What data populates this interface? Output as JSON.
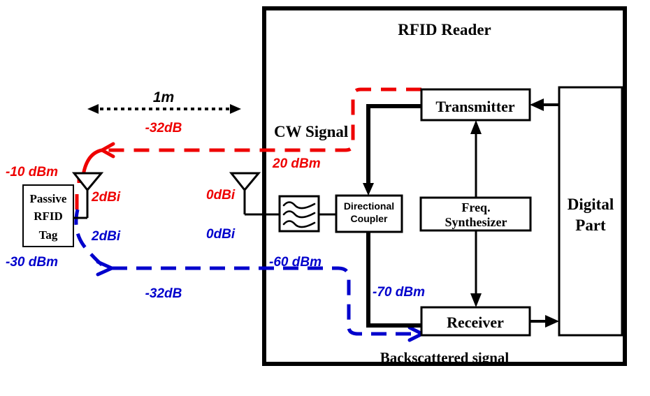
{
  "diagram": {
    "title": "RFID Reader",
    "reader_label": "RFID Reader",
    "bottom_label": "Backscattered signal",
    "cw_label": "CW Signal",
    "distance_label": "1m",
    "colors": {
      "forward_path": "#ee0000",
      "backscatter_path": "#0000cc",
      "wire": "#000000",
      "background": "#ffffff"
    },
    "blocks": [
      {
        "id": "tag",
        "label": "Passive\nRFID\nTag",
        "lines": [
          "Passive",
          "RFID",
          "Tag"
        ]
      },
      {
        "id": "filter",
        "label": "",
        "icon": "bandpass-filter-icon"
      },
      {
        "id": "directional-coupler",
        "label": "Directional\nCoupler",
        "lines": [
          "Directional",
          "Coupler"
        ]
      },
      {
        "id": "transmitter",
        "label": "Transmitter"
      },
      {
        "id": "freq-synthesizer",
        "label": "Freq.\nSynthesizer",
        "lines": [
          "Freq.",
          "Synthesizer"
        ]
      },
      {
        "id": "receiver",
        "label": "Receiver"
      },
      {
        "id": "digital-part",
        "label": "Digital\nPart",
        "lines": [
          "Digital",
          "Part"
        ]
      }
    ],
    "block_labels": {
      "tag_line1": "Passive",
      "tag_line2": "RFID",
      "tag_line3": "Tag",
      "coupler_line1": "Directional",
      "coupler_line2": "Coupler",
      "transmitter": "Transmitter",
      "synth_line1": "Freq.",
      "synth_line2": "Synthesizer",
      "receiver": "Receiver",
      "digital_line1": "Digital",
      "digital_line2": "Part"
    },
    "forward_link": {
      "name": "CW Signal",
      "tx_power": "20 dBm",
      "path_loss": "-32dB",
      "tag_received": "-10 dBm",
      "reader_antenna_gain": "0dBi",
      "tag_antenna_gain": "2dBi"
    },
    "reverse_link": {
      "name": "Backscattered signal",
      "tag_backscatter": "-30 dBm",
      "path_loss": "-32dB",
      "reader_antenna_received": "-60 dBm",
      "receiver_input": "-70 dBm",
      "reader_antenna_gain": "0dBi",
      "tag_antenna_gain": "2dBi"
    },
    "annotations": [
      {
        "id": "distance",
        "text": "1m",
        "color": "#000000"
      },
      {
        "id": "fwd-path-loss",
        "text": "-32dB",
        "color": "#ee0000"
      },
      {
        "id": "tag-rx-power",
        "text": "-10 dBm",
        "color": "#ee0000"
      },
      {
        "id": "tag-gain-fwd",
        "text": "2dBi",
        "color": "#ee0000"
      },
      {
        "id": "reader-gain-fwd",
        "text": "0dBi",
        "color": "#ee0000"
      },
      {
        "id": "tx-power",
        "text": "20 dBm",
        "color": "#ee0000"
      },
      {
        "id": "tag-gain-rev",
        "text": "2dBi",
        "color": "#0000cc"
      },
      {
        "id": "reader-gain-rev",
        "text": "0dBi",
        "color": "#0000cc"
      },
      {
        "id": "tag-backscatter-power",
        "text": "-30 dBm",
        "color": "#0000cc"
      },
      {
        "id": "rev-path-loss",
        "text": "-32dB",
        "color": "#0000cc"
      },
      {
        "id": "antenna-rx-power",
        "text": "-60 dBm",
        "color": "#0000cc"
      },
      {
        "id": "receiver-input-power",
        "text": "-70 dBm",
        "color": "#0000cc"
      }
    ]
  }
}
